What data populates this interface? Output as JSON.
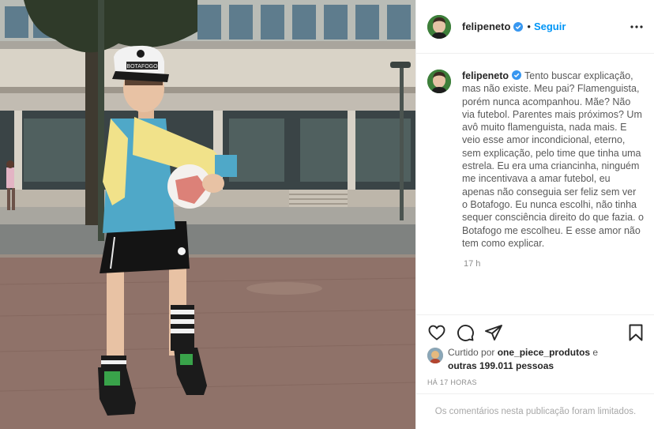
{
  "post": {
    "author": {
      "username": "felipeneto",
      "verified": true,
      "avatar_icon": "profile-avatar"
    },
    "follow_separator": "•",
    "follow_label": "Seguir",
    "more_icon": "more-options-icon",
    "caption": "Tento buscar explicação, mas não existe. Meu pai? Flamenguista, porém nunca acompanhou. Mãe? Não via futebol. Parentes mais próximos? Um avô muito flamenguista, nada mais. E veio esse amor incondicional, eterno, sem explicação, pelo time que tinha uma estrela. Eu era uma criancinha, ninguém me incentivava a amar futebol, eu apenas não conseguia ser feliz sem ver o Botafogo. Eu nunca escolhi, não tinha sequer consciência direito do que fazia. o Botafogo me escolheu. E esse amor não tem como explicar.",
    "time_ago": "17 h",
    "actions": {
      "like_icon": "heart-icon",
      "comment_icon": "comment-icon",
      "share_icon": "share-icon",
      "save_icon": "bookmark-icon"
    },
    "likes": {
      "prefix": "Curtido por",
      "user": "one_piece_produtos",
      "connector": "e",
      "others": "outras 199.011 pessoas"
    },
    "posted_ago": "HÁ 17 HORAS",
    "comments_limited": "Os comentários nesta publicação foram limitados."
  },
  "photo": {
    "description_icon": "post-photo",
    "cap_text": "BOTAFOGO"
  },
  "colors": {
    "accent_blue": "#0095f6",
    "text": "#262626",
    "muted": "#8e8e8e",
    "border": "#efefef"
  }
}
